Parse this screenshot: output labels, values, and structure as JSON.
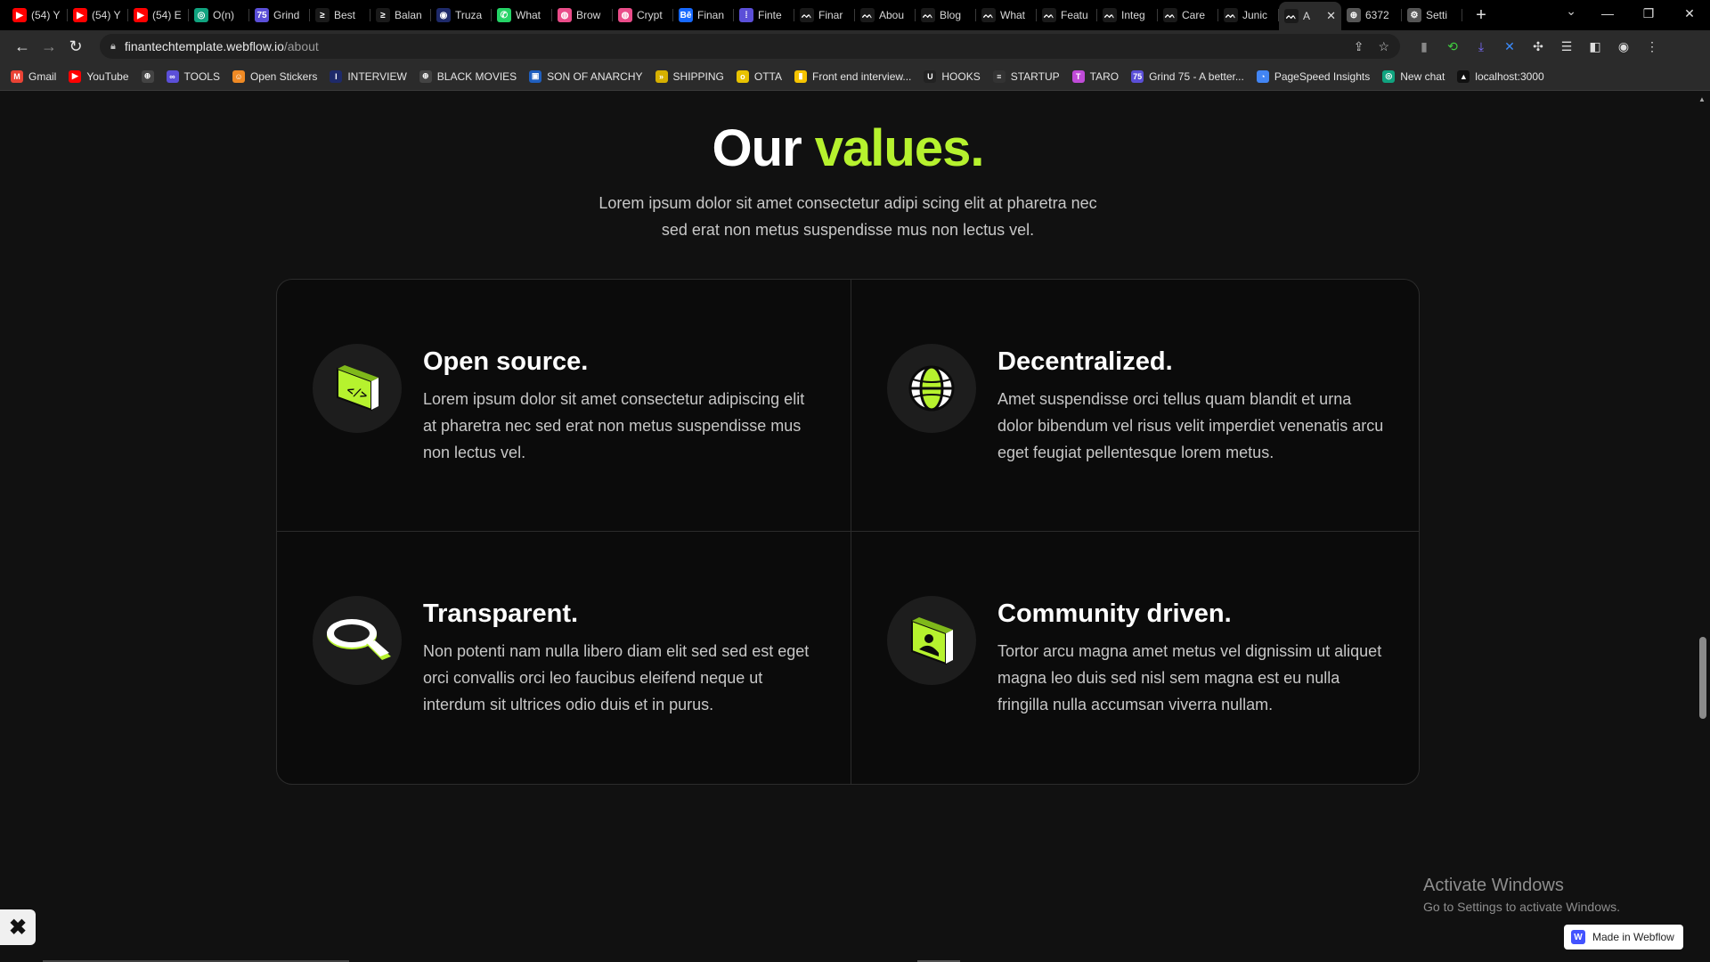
{
  "browser": {
    "tabs": [
      {
        "title": "(54) Y",
        "fav_color": "#ff0000",
        "fav_text": "▶"
      },
      {
        "title": "(54) Y",
        "fav_color": "#ff0000",
        "fav_text": "▶"
      },
      {
        "title": "(54) E",
        "fav_color": "#ff0000",
        "fav_text": "▶"
      },
      {
        "title": "O(n)",
        "fav_color": "#10a37f",
        "fav_text": "◎"
      },
      {
        "title": "Grind",
        "fav_color": "#5b4fd8",
        "fav_text": "75"
      },
      {
        "title": "Best",
        "fav_color": "#1a1a1a",
        "fav_text": "≥"
      },
      {
        "title": "Balan",
        "fav_color": "#1a1a1a",
        "fav_text": "≥"
      },
      {
        "title": "Truza",
        "fav_color": "#1e2a6a",
        "fav_text": "◉"
      },
      {
        "title": "What",
        "fav_color": "#25d366",
        "fav_text": "✆"
      },
      {
        "title": "Brow",
        "fav_color": "#ea4c89",
        "fav_text": "◍"
      },
      {
        "title": "Crypt",
        "fav_color": "#ea4c89",
        "fav_text": "◍"
      },
      {
        "title": "Finan",
        "fav_color": "#1769ff",
        "fav_text": "Bē"
      },
      {
        "title": "Finte",
        "fav_color": "#5b4fd8",
        "fav_text": "⁞"
      },
      {
        "title": "Finar",
        "fav_color": "#1a1a1a",
        "fav_text": "ᨓ"
      },
      {
        "title": "Abou",
        "fav_color": "#1a1a1a",
        "fav_text": "ᨓ"
      },
      {
        "title": "Blog",
        "fav_color": "#1a1a1a",
        "fav_text": "ᨓ"
      },
      {
        "title": "What",
        "fav_color": "#1a1a1a",
        "fav_text": "ᨓ"
      },
      {
        "title": "Featu",
        "fav_color": "#1a1a1a",
        "fav_text": "ᨓ"
      },
      {
        "title": "Integ",
        "fav_color": "#1a1a1a",
        "fav_text": "ᨓ"
      },
      {
        "title": "Care",
        "fav_color": "#1a1a1a",
        "fav_text": "ᨓ"
      },
      {
        "title": "Junic",
        "fav_color": "#1a1a1a",
        "fav_text": "ᨓ"
      }
    ],
    "active_tab": {
      "title": "A",
      "fav_color": "#1a1a1a",
      "fav_text": "ᨓ"
    },
    "after_tabs": [
      {
        "title": "6372",
        "fav_color": "#555555",
        "fav_text": "⊕"
      },
      {
        "title": "Setti",
        "fav_color": "#555555",
        "fav_text": "⚙"
      }
    ],
    "new_tab_label": "+",
    "url_host": "finantechtemplate.webflow.io",
    "url_path": "/about",
    "bookmarks": [
      {
        "label": "Gmail",
        "color": "#ea4335",
        "glyph": "M"
      },
      {
        "label": "YouTube",
        "color": "#ff0000",
        "glyph": "▶"
      },
      {
        "label": "",
        "color": "#444444",
        "glyph": "⊕"
      },
      {
        "label": "TOOLS",
        "color": "#5b4fd8",
        "glyph": "∞"
      },
      {
        "label": "Open Stickers",
        "color": "#f08a24",
        "glyph": "☺"
      },
      {
        "label": "INTERVIEW",
        "color": "#1e2a6a",
        "glyph": "I"
      },
      {
        "label": "BLACK MOVIES",
        "color": "#444444",
        "glyph": "⊕"
      },
      {
        "label": "SON OF ANARCHY",
        "color": "#1f5fbf",
        "glyph": "▣"
      },
      {
        "label": "SHIPPING",
        "color": "#d6b000",
        "glyph": "»"
      },
      {
        "label": "OTTA",
        "color": "#e8c300",
        "glyph": "o"
      },
      {
        "label": "Front end interview...",
        "color": "#f5c400",
        "glyph": "▮"
      },
      {
        "label": "HOOKS",
        "color": "#222222",
        "glyph": "U"
      },
      {
        "label": "STARTUP",
        "color": "#333333",
        "glyph": "≡"
      },
      {
        "label": "TARO",
        "color": "#c04bd8",
        "glyph": "T"
      },
      {
        "label": "Grind 75 - A better...",
        "color": "#5b4fd8",
        "glyph": "75"
      },
      {
        "label": "PageSpeed Insights",
        "color": "#4285f4",
        "glyph": "◔"
      },
      {
        "label": "New chat",
        "color": "#10a37f",
        "glyph": "◎"
      },
      {
        "label": "localhost:3000",
        "color": "#111111",
        "glyph": "▲"
      }
    ]
  },
  "values_section": {
    "title_prefix": "Our",
    "title_accent": "values.",
    "subtitle": "Lorem ipsum dolor sit amet consectetur adipi scing elit at pharetra nec sed erat non metus suspendisse mus non lectus vel.",
    "accent_color": "#b6f22e",
    "items": [
      {
        "icon": "code-card-icon",
        "title": "Open source.",
        "text": "Lorem ipsum dolor sit amet consectetur adipiscing elit at pharetra nec sed erat non metus suspendisse mus non lectus vel."
      },
      {
        "icon": "globe-icon",
        "title": "Decentralized.",
        "text": "Amet suspendisse orci tellus quam blandit et urna dolor bibendum vel risus velit imperdiet venenatis arcu eget feugiat pellentesque lorem metus."
      },
      {
        "icon": "magnifier-icon",
        "title": "Transparent.",
        "text": "Non potenti nam nulla libero diam elit sed sed est eget orci convallis orci leo faucibus eleifend neque ut interdum sit ultrices odio duis et in purus."
      },
      {
        "icon": "user-card-icon",
        "title": "Community driven.",
        "text": "Tortor arcu magna amet metus vel dignissim ut aliquet magna leo duis sed nisl sem magna est eu nulla fringilla nulla accumsan viverra nullam."
      }
    ]
  },
  "os_overlay": {
    "activate_title": "Activate Windows",
    "activate_sub": "Go to Settings to activate Windows."
  },
  "webflow_badge": "Made in Webflow"
}
